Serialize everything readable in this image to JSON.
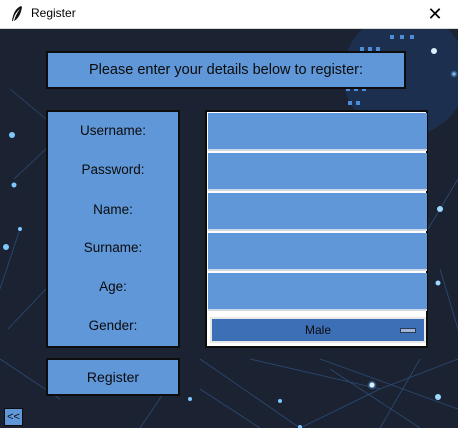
{
  "window": {
    "title": "Register",
    "icon": "feather-icon",
    "close_icon": "close-icon",
    "close_glyph": "✕"
  },
  "header": {
    "text": "Please enter your details below to register:"
  },
  "form": {
    "labels": {
      "username": "Username:",
      "password": "Password:",
      "name": "Name:",
      "surname": "Surname:",
      "age": "Age:",
      "gender": "Gender:"
    },
    "values": {
      "username": "",
      "password": "",
      "name": "",
      "surname": "",
      "age": ""
    },
    "gender_selected": "Male"
  },
  "buttons": {
    "register": "Register",
    "back": "<<"
  },
  "colors": {
    "panel": "#5f97d8",
    "background": "#1a2233",
    "select": "#3d6fb6"
  }
}
